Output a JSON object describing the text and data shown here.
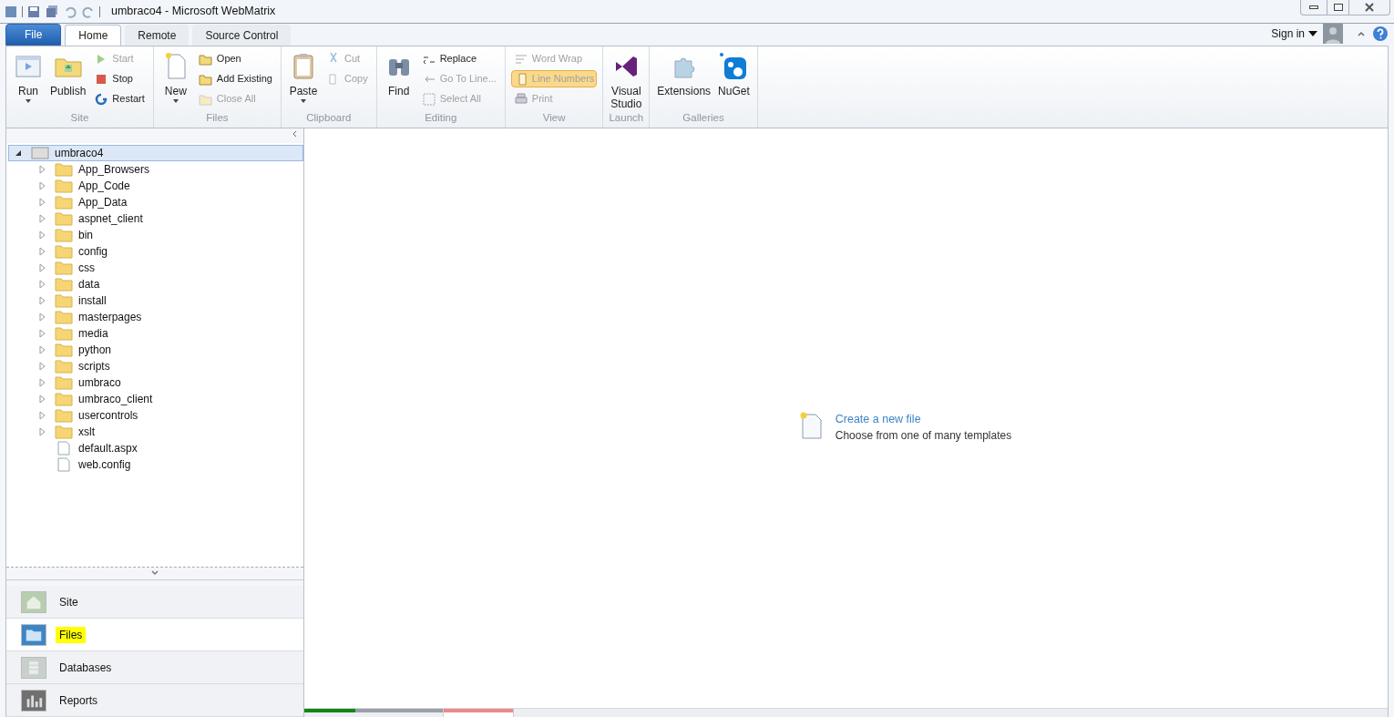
{
  "window": {
    "title": "umbraco4 - Microsoft WebMatrix"
  },
  "ribbon_tabs": [
    {
      "label": "File",
      "kind": "file",
      "selected": false
    },
    {
      "label": "Home",
      "kind": "tab",
      "selected": true
    },
    {
      "label": "Remote",
      "kind": "tab",
      "selected": false
    },
    {
      "label": "Source Control",
      "kind": "tab",
      "selected": false
    }
  ],
  "account": {
    "label": "Sign in"
  },
  "ribbon_groups": [
    {
      "label": "Site",
      "items": [
        {
          "label": "Run",
          "kind": "large",
          "dropdown": true,
          "disabled": false,
          "on": false
        },
        {
          "label": "Publish",
          "kind": "large",
          "dropdown": false,
          "disabled": false,
          "on": false
        },
        {
          "kind": "stack",
          "items": [
            {
              "label": "Start",
              "disabled": true,
              "on": false
            },
            {
              "label": "Stop",
              "disabled": false,
              "on": false
            },
            {
              "label": "Restart",
              "disabled": false,
              "on": false
            }
          ]
        }
      ]
    },
    {
      "label": "Files",
      "items": [
        {
          "label": "New",
          "kind": "large",
          "dropdown": true,
          "disabled": false,
          "on": false
        },
        {
          "kind": "stack",
          "items": [
            {
              "label": "Open",
              "disabled": false,
              "on": false
            },
            {
              "label": "Add Existing",
              "disabled": false,
              "on": false
            },
            {
              "label": "Close All",
              "disabled": true,
              "on": false
            }
          ]
        }
      ]
    },
    {
      "label": "Clipboard",
      "items": [
        {
          "label": "Paste",
          "kind": "large",
          "dropdown": true,
          "disabled": false,
          "on": false
        },
        {
          "kind": "stack",
          "items": [
            {
              "label": "Cut",
              "disabled": true,
              "on": false
            },
            {
              "label": "Copy",
              "disabled": true,
              "on": false
            }
          ]
        }
      ]
    },
    {
      "label": "Editing",
      "items": [
        {
          "label": "Find",
          "kind": "large",
          "dropdown": false,
          "disabled": false,
          "on": false
        },
        {
          "kind": "stack",
          "items": [
            {
              "label": "Replace",
              "disabled": false,
              "on": false
            },
            {
              "label": "Go To Line...",
              "disabled": true,
              "on": false
            },
            {
              "label": "Select All",
              "disabled": true,
              "on": false
            }
          ]
        }
      ]
    },
    {
      "label": "View",
      "items": [
        {
          "kind": "stack",
          "items": [
            {
              "label": "Word Wrap",
              "disabled": true,
              "on": false
            },
            {
              "label": "Line Numbers",
              "disabled": true,
              "on": true
            },
            {
              "label": "Print",
              "disabled": true,
              "on": false
            }
          ]
        }
      ]
    },
    {
      "label": "Launch",
      "items": [
        {
          "label": "Visual Studio",
          "kind": "large",
          "dropdown": false,
          "disabled": false,
          "on": false
        }
      ]
    },
    {
      "label": "Galleries",
      "items": [
        {
          "label": "Extensions",
          "kind": "large",
          "dropdown": false,
          "disabled": false,
          "on": false
        },
        {
          "label": "NuGet",
          "kind": "large",
          "dropdown": false,
          "disabled": false,
          "on": false
        }
      ]
    }
  ],
  "tree": [
    {
      "label": "umbraco4",
      "kind": "site",
      "expanded": true,
      "selected": true,
      "children": [
        {
          "label": "App_Browsers",
          "kind": "folder",
          "expanded": false,
          "selected": false
        },
        {
          "label": "App_Code",
          "kind": "folder",
          "expanded": false,
          "selected": false
        },
        {
          "label": "App_Data",
          "kind": "folder",
          "expanded": false,
          "selected": false
        },
        {
          "label": "aspnet_client",
          "kind": "folder",
          "expanded": false,
          "selected": false
        },
        {
          "label": "bin",
          "kind": "folder",
          "expanded": false,
          "selected": false
        },
        {
          "label": "config",
          "kind": "folder",
          "expanded": false,
          "selected": false
        },
        {
          "label": "css",
          "kind": "folder",
          "expanded": false,
          "selected": false
        },
        {
          "label": "data",
          "kind": "folder",
          "expanded": false,
          "selected": false
        },
        {
          "label": "install",
          "kind": "folder",
          "expanded": false,
          "selected": false
        },
        {
          "label": "masterpages",
          "kind": "folder",
          "expanded": false,
          "selected": false
        },
        {
          "label": "media",
          "kind": "folder",
          "expanded": false,
          "selected": false
        },
        {
          "label": "python",
          "kind": "folder",
          "expanded": false,
          "selected": false
        },
        {
          "label": "scripts",
          "kind": "folder",
          "expanded": false,
          "selected": false
        },
        {
          "label": "umbraco",
          "kind": "folder",
          "expanded": false,
          "selected": false
        },
        {
          "label": "umbraco_client",
          "kind": "folder",
          "expanded": false,
          "selected": false
        },
        {
          "label": "usercontrols",
          "kind": "folder",
          "expanded": false,
          "selected": false
        },
        {
          "label": "xslt",
          "kind": "folder",
          "expanded": false,
          "selected": false
        },
        {
          "label": "default.aspx",
          "kind": "file",
          "selected": false
        },
        {
          "label": "web.config",
          "kind": "file",
          "selected": false
        }
      ]
    }
  ],
  "workspaces": [
    {
      "label": "Site",
      "kind": "site",
      "selected": false,
      "highlighted": false
    },
    {
      "label": "Files",
      "kind": "files",
      "selected": true,
      "highlighted": true
    },
    {
      "label": "Databases",
      "kind": "databases",
      "selected": false,
      "highlighted": false
    },
    {
      "label": "Reports",
      "kind": "reports",
      "selected": false,
      "highlighted": false
    }
  ],
  "start_hint": {
    "link": "Create a new file",
    "description": "Choose from one of many templates"
  },
  "document_tabs": [
    {
      "color": "#118811",
      "level": 0.37,
      "selected": false
    },
    {
      "color": "#ee8888",
      "level": 1,
      "selected": true
    }
  ]
}
